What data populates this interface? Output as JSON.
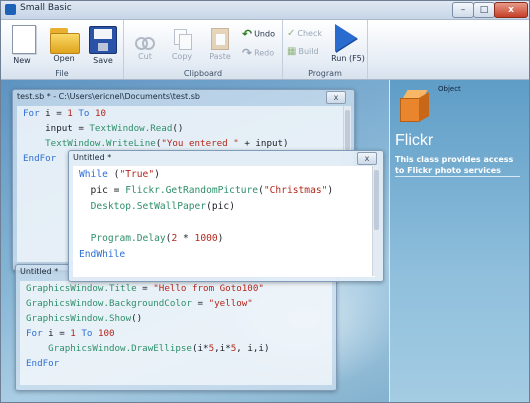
{
  "app": {
    "title": "Small Basic"
  },
  "window_controls": {
    "minimize": "–",
    "maximize": "□",
    "close": "x"
  },
  "ribbon": {
    "file_group": {
      "label": "File",
      "new": "New",
      "open": "Open",
      "save": "Save"
    },
    "clipboard_group": {
      "label": "Clipboard",
      "cut": "Cut",
      "copy": "Copy",
      "paste": "Paste",
      "undo": "Undo",
      "redo": "Redo"
    },
    "program_group": {
      "label": "Program",
      "check": "Check",
      "build": "Build",
      "run": "Run (F5)"
    }
  },
  "editors": {
    "testsb": {
      "title": "test.sb * - C:\\Users\\ericnel\\Documents\\test.sb",
      "close": "x",
      "lines": [
        [
          [
            "kw",
            "For "
          ],
          [
            "id",
            "i = "
          ],
          [
            "num",
            "1"
          ],
          [
            "kw",
            " To "
          ],
          [
            "num",
            "10"
          ]
        ],
        [
          [
            "id",
            "    input = "
          ],
          [
            "fn",
            "TextWindow.Read"
          ],
          [
            "id",
            "()"
          ]
        ],
        [
          [
            "id",
            "    "
          ],
          [
            "fn",
            "TextWindow.WriteLine"
          ],
          [
            "id",
            "("
          ],
          [
            "str",
            "\"You entered \""
          ],
          [
            "id",
            " + input)"
          ]
        ],
        [
          [
            "kw",
            "EndFor"
          ]
        ]
      ]
    },
    "untitled_front": {
      "title": "Untitled *",
      "close": "x",
      "lines": [
        [
          [
            "kw",
            "While "
          ],
          [
            "id",
            "("
          ],
          [
            "str",
            "\"True\""
          ],
          [
            "id",
            ")"
          ]
        ],
        [
          [
            "id",
            "  pic = "
          ],
          [
            "fn",
            "Flickr.GetRandomPicture"
          ],
          [
            "id",
            "("
          ],
          [
            "str",
            "\"Christmas\""
          ],
          [
            "id",
            ")"
          ]
        ],
        [
          [
            "id",
            "  "
          ],
          [
            "fn",
            "Desktop.SetWallPaper"
          ],
          [
            "id",
            "(pic)"
          ]
        ],
        [
          [
            "id",
            ""
          ]
        ],
        [
          [
            "id",
            "  "
          ],
          [
            "fn",
            "Program.Delay"
          ],
          [
            "id",
            "("
          ],
          [
            "num",
            "2"
          ],
          [
            "id",
            " * "
          ],
          [
            "num",
            "1000"
          ],
          [
            "id",
            ")"
          ]
        ],
        [
          [
            "kw",
            "EndWhile"
          ]
        ]
      ]
    },
    "untitled_back": {
      "title": "Untitled *",
      "lines": [
        [
          [
            "fn",
            "GraphicsWindow.Title"
          ],
          [
            "id",
            " = "
          ],
          [
            "str",
            "\"Hello from Goto100\""
          ]
        ],
        [
          [
            "fn",
            "GraphicsWindow.BackgroundColor"
          ],
          [
            "id",
            " = "
          ],
          [
            "str",
            "\"yellow\""
          ]
        ],
        [
          [
            "fn",
            "GraphicsWindow.Show"
          ],
          [
            "id",
            "()"
          ]
        ],
        [
          [
            "kw",
            "For "
          ],
          [
            "id",
            "i = "
          ],
          [
            "num",
            "1"
          ],
          [
            "kw",
            " To "
          ],
          [
            "num",
            "100"
          ]
        ],
        [
          [
            "id",
            "    "
          ],
          [
            "fn",
            "GraphicsWindow.DrawEllipse"
          ],
          [
            "id",
            "(i*"
          ],
          [
            "num",
            "5"
          ],
          [
            "id",
            ",i*"
          ],
          [
            "num",
            "5"
          ],
          [
            "id",
            ", i,i)"
          ]
        ],
        [
          [
            "kw",
            "EndFor"
          ]
        ]
      ]
    }
  },
  "object_panel": {
    "tag": "Object",
    "name": "Flickr",
    "description": "This class provides access to Flickr photo services"
  },
  "colors": {
    "keyword": "#2e6fd4",
    "function": "#2e8f6a",
    "string": "#b3271b",
    "run": "#2a6bd0"
  }
}
